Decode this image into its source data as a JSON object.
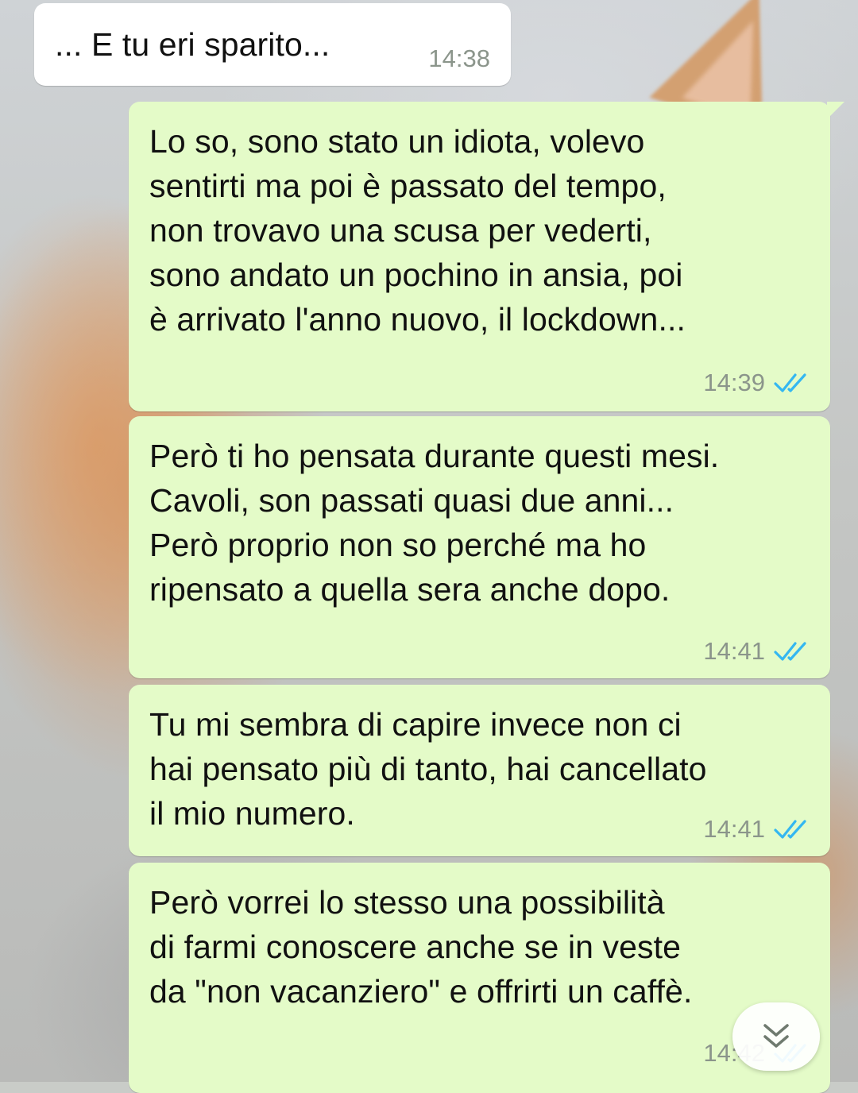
{
  "messages": [
    {
      "direction": "incoming",
      "text": "... E tu eri sparito...",
      "time": "14:38"
    },
    {
      "direction": "outgoing",
      "text": "Lo so, sono stato un idiota, volevo\nsentirti ma poi è passato del tempo,\nnon trovavo una scusa per vederti,\nsono andato un pochino in ansia, poi\nè arrivato l'anno nuovo, il lockdown...",
      "time": "14:39",
      "status": "read"
    },
    {
      "direction": "outgoing",
      "text": "Però ti ho pensata durante questi mesi.\nCavoli, son passati quasi due anni...\nPerò proprio non so perché ma ho\nripensato a quella sera anche dopo.",
      "time": "14:41",
      "status": "read"
    },
    {
      "direction": "outgoing",
      "text": "Tu mi sembra di capire invece non ci\nhai pensato più di tanto, hai cancellato\nil mio numero.",
      "time": "14:41",
      "status": "read"
    },
    {
      "direction": "outgoing",
      "text": "Però vorrei lo stesso una possibilità\ndi farmi conoscere anche se in veste\nda \"non vacanziero\" e offrirti un caffè.",
      "time": "14:42",
      "status": "read"
    }
  ],
  "icons": {
    "read_ticks": "double-check-icon",
    "scroll_down": "chevron-double-down-icon"
  },
  "colors": {
    "incoming_bubble": "#ffffff",
    "outgoing_bubble": "#e4fbc8",
    "read_ticks": "#34b7f1",
    "timestamp": "#8b958b"
  }
}
